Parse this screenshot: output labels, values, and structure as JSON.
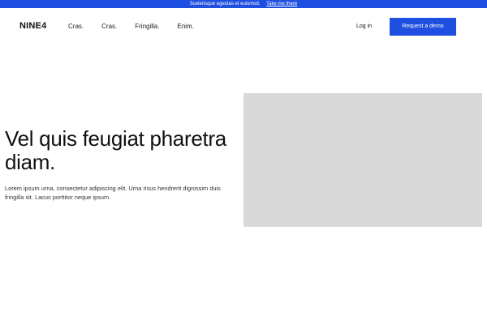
{
  "announcement": {
    "text": "Scelerisque egestas et euismod.",
    "link": "Take me there"
  },
  "nav": {
    "logo": "NINE4",
    "links": [
      "Cras.",
      "Cras.",
      "Fringilla.",
      "Enim."
    ],
    "login": "Log in",
    "cta": "Request a demo"
  },
  "hero": {
    "title": "Vel quis feugiat pharetra diam.",
    "body": "Lorem ipsum urna, consectetur adipiscing elit. Urna risus hendrerit dignissim duis fringilla sit. Lacus porttitor neque ipsum."
  },
  "colors": {
    "accent": "#1f4fe0",
    "image_placeholder": "#d9d9d9"
  }
}
